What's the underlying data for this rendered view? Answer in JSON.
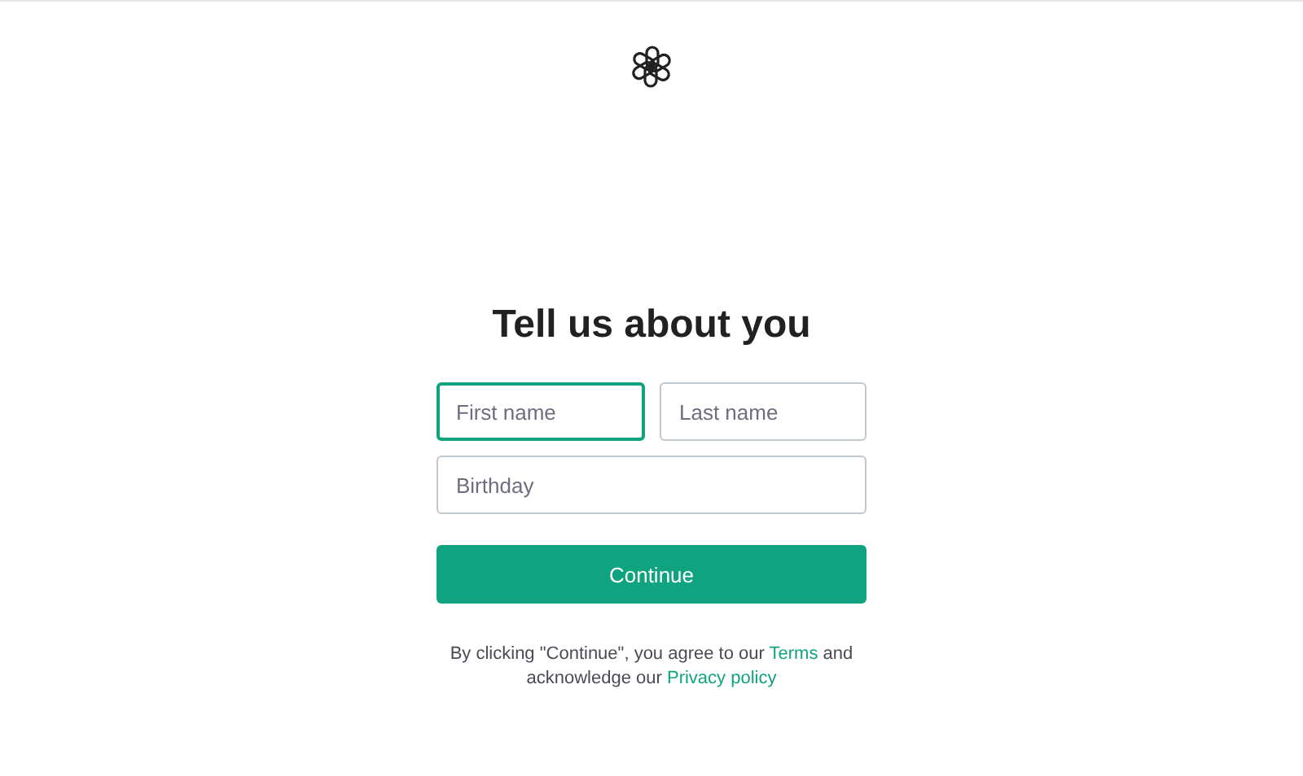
{
  "title": "Tell us about you",
  "name_fields": [
    {
      "placeholder": "First name",
      "focused": true
    },
    {
      "placeholder": "Last name",
      "focused": false
    }
  ],
  "birthday_field": {
    "placeholder": "Birthday",
    "focused": false
  },
  "button": "Continue",
  "legal": [
    {
      "kind": "text",
      "text": "By clicking \"Continue\", you agree to our "
    },
    {
      "kind": "link",
      "text": "Terms"
    },
    {
      "kind": "text",
      "text": " and acknowledge our "
    },
    {
      "kind": "link",
      "text": "Privacy policy"
    }
  ]
}
